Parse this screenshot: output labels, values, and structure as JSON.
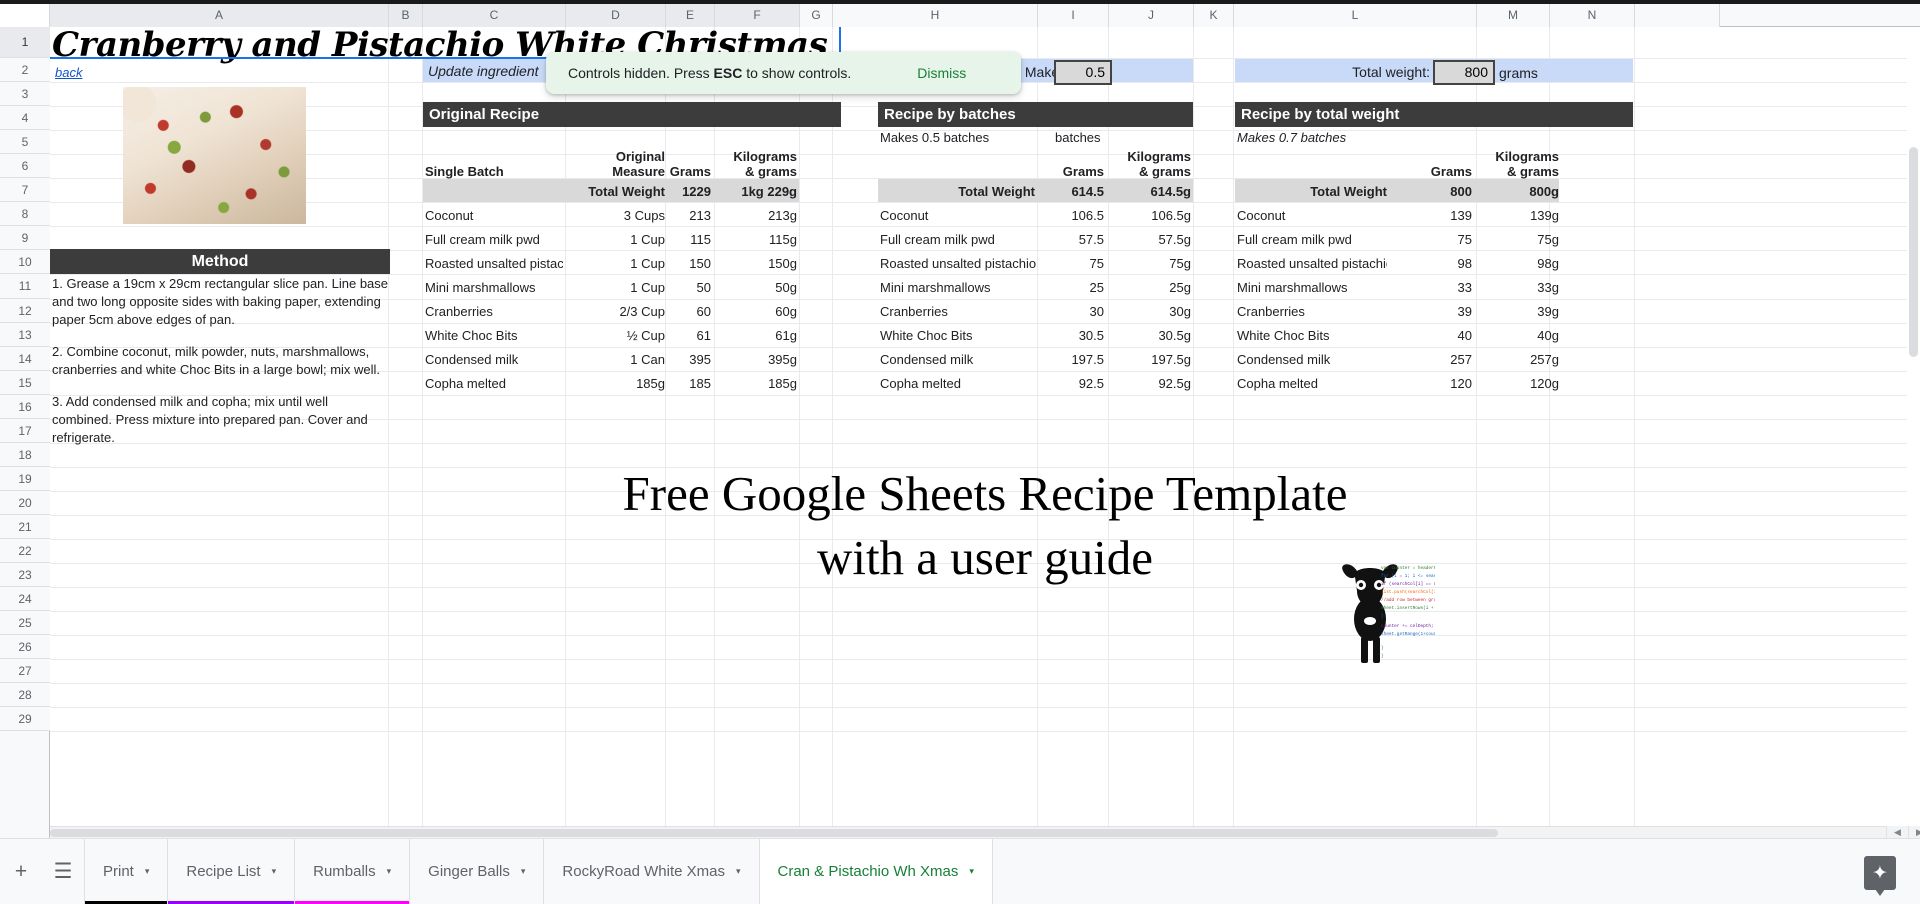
{
  "app": {
    "columns": [
      "A",
      "B",
      "C",
      "D",
      "E",
      "F",
      "G",
      "H",
      "I",
      "J",
      "K",
      "L",
      "M",
      "N"
    ],
    "row_numbers": [
      "1",
      "2",
      "3",
      "4",
      "5",
      "6",
      "7",
      "8",
      "9",
      "10",
      "11",
      "12",
      "13",
      "14",
      "15",
      "16",
      "17",
      "18",
      "19",
      "20",
      "21",
      "22",
      "23",
      "24",
      "25",
      "26",
      "27",
      "28",
      "29"
    ]
  },
  "toast": {
    "message_pre": "Controls hidden. Press ",
    "message_key": "ESC",
    "message_post": " to show controls.",
    "dismiss_label": "Dismiss",
    "bg_color": "#e6f4ea",
    "dismiss_color": "#188038"
  },
  "sheet": {
    "title": "Cranberry and Pistachio White Christmas",
    "back_link": "back",
    "update_note": "Update ingredient",
    "batches_label": "Makes:",
    "batches_value": "0.5",
    "total_weight_label": "Total weight:",
    "total_weight_value": "800",
    "total_weight_unit": "grams",
    "promo_line1": "Free Google Sheets Recipe Template",
    "promo_line2": "with a user guide"
  },
  "method": {
    "heading": "Method",
    "steps": [
      "1. Grease a 19cm x 29cm rectangular slice pan. Line base and two long opposite sides with baking paper, extending paper 5cm above edges of pan.",
      "2. Combine coconut, milk powder, nuts, marshmallows, cranberries and white Choc Bits in a large bowl; mix well.",
      "3. Add condensed milk and copha; mix until well combined. Press mixture into prepared pan. Cover and refrigerate."
    ]
  },
  "tables": {
    "original": {
      "banner": "Original Recipe",
      "col_name": "Single Batch",
      "col_measure": "Original\nMeasure",
      "col_measure_l1": "Original",
      "col_measure_l2": "Measure",
      "col_grams": "Grams",
      "col_kg_l1": "Kilograms",
      "col_kg_l2": "& grams",
      "total_label": "Total Weight",
      "total_grams": "1229",
      "total_kg": "1kg 229g",
      "rows": [
        {
          "name": "Coconut",
          "measure": "3 Cups",
          "grams": "213",
          "kg": "213g"
        },
        {
          "name": "Full cream milk pwd",
          "measure": "1 Cup",
          "grams": "115",
          "kg": "115g"
        },
        {
          "name": "Roasted unsalted pistachio nu",
          "measure": "1 Cup",
          "grams": "150",
          "kg": "150g"
        },
        {
          "name": "Mini marshmallows",
          "measure": "1 Cup",
          "grams": "50",
          "kg": "50g"
        },
        {
          "name": "Cranberries",
          "measure": "2/3 Cup",
          "grams": "60",
          "kg": "60g"
        },
        {
          "name": "White Choc Bits",
          "measure": "½ Cup",
          "grams": "61",
          "kg": "61g"
        },
        {
          "name": "Condensed milk",
          "measure": "1 Can",
          "grams": "395",
          "kg": "395g"
        },
        {
          "name": "Copha melted",
          "measure": "185g",
          "grams": "185",
          "kg": "185g"
        }
      ]
    },
    "by_batches": {
      "banner": "Recipe by batches",
      "makes_text": "Makes 0.5 batches",
      "batches_word": "batches",
      "col_grams": "Grams",
      "col_kg_l1": "Kilograms",
      "col_kg_l2": "& grams",
      "total_label": "Total Weight",
      "total_grams": "614.5",
      "total_kg": "614.5g",
      "rows": [
        {
          "name": "Coconut",
          "grams": "106.5",
          "kg": "106.5g"
        },
        {
          "name": "Full cream milk pwd",
          "grams": "57.5",
          "kg": "57.5g"
        },
        {
          "name": "Roasted unsalted pistachio nu",
          "grams": "75",
          "kg": "75g"
        },
        {
          "name": "Mini marshmallows",
          "grams": "25",
          "kg": "25g"
        },
        {
          "name": "Cranberries",
          "grams": "30",
          "kg": "30g"
        },
        {
          "name": "White Choc Bits",
          "grams": "30.5",
          "kg": "30.5g"
        },
        {
          "name": "Condensed milk",
          "grams": "197.5",
          "kg": "197.5g"
        },
        {
          "name": "Copha melted",
          "grams": "92.5",
          "kg": "92.5g"
        }
      ]
    },
    "by_total_weight": {
      "banner": "Recipe by total weight",
      "makes_text": "Makes 0.7 batches",
      "col_grams": "Grams",
      "col_kg_l1": "Kilograms",
      "col_kg_l2": "& grams",
      "total_label": "Total Weight",
      "total_grams": "800",
      "total_kg": "800g",
      "rows": [
        {
          "name": "Coconut",
          "grams": "139",
          "kg": "139g"
        },
        {
          "name": "Full cream milk pwd",
          "grams": "75",
          "kg": "75g"
        },
        {
          "name": "Roasted unsalted pistachio nu",
          "grams": "98",
          "kg": "98g"
        },
        {
          "name": "Mini marshmallows",
          "grams": "33",
          "kg": "33g"
        },
        {
          "name": "Cranberries",
          "grams": "39",
          "kg": "39g"
        },
        {
          "name": "White Choc Bits",
          "grams": "40",
          "kg": "40g"
        },
        {
          "name": "Condensed milk",
          "grams": "257",
          "kg": "257g"
        },
        {
          "name": "Copha melted",
          "grams": "120",
          "kg": "120g"
        }
      ]
    }
  },
  "tabbar": {
    "add_icon": "+",
    "all_sheets_icon": "☰",
    "tabs": [
      {
        "label": "Print",
        "underline": "#000000",
        "active": false
      },
      {
        "label": "Recipe List",
        "underline": "#9900ff",
        "active": false
      },
      {
        "label": "Rumballs",
        "underline": "#ff00ff",
        "active": false
      },
      {
        "label": "Ginger Balls",
        "underline": "",
        "active": false
      },
      {
        "label": "RockyRoad White Xmas",
        "underline": "",
        "active": false
      },
      {
        "label": "Cran & Pistachio Wh Xmas",
        "underline": "",
        "active": true
      }
    ],
    "caret": "▾",
    "explore_icon": "✦"
  }
}
